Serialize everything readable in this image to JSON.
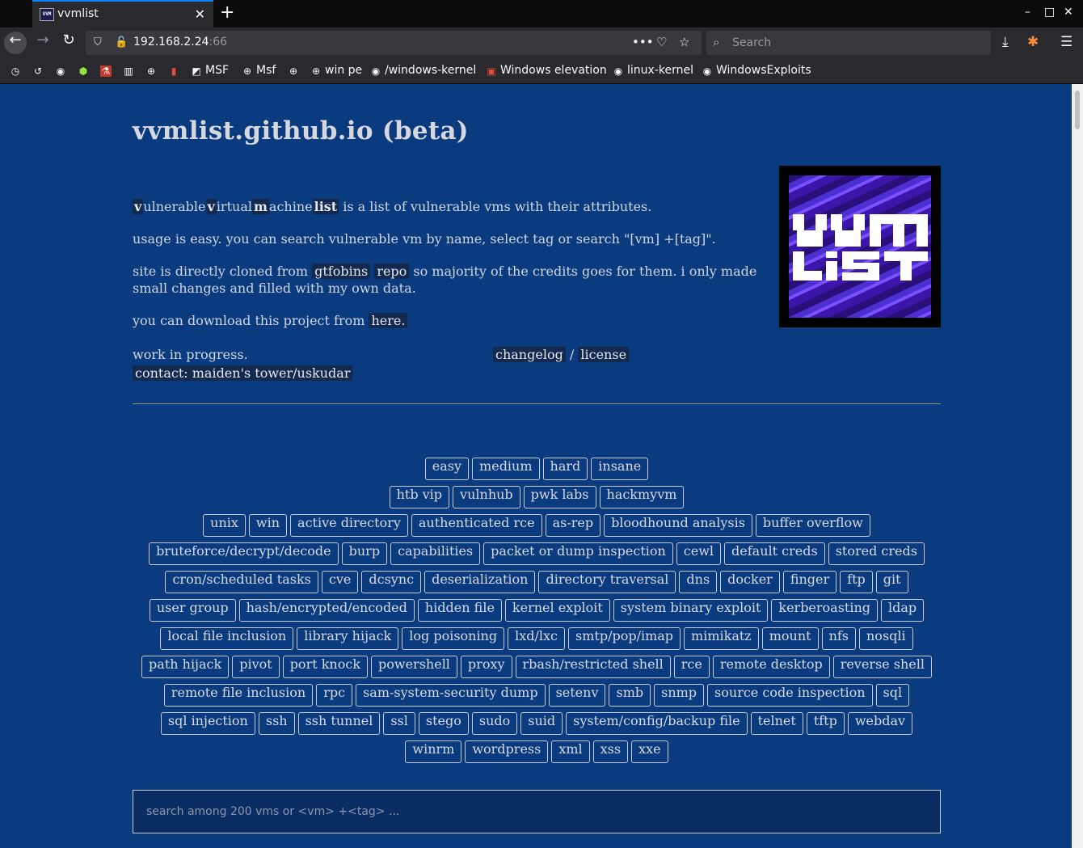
{
  "browser": {
    "tab_title": "vvmlist",
    "tab_favicon_text": "VVM",
    "url_host": "192.168.2.24",
    "url_port": ":66",
    "search_placeholder": "Search",
    "window_controls": {
      "minimize": "–",
      "maximize": "□",
      "close": "✕"
    },
    "bookmarks": [
      {
        "label": "",
        "icon": "clock-icon"
      },
      {
        "label": "",
        "icon": "history-icon"
      },
      {
        "label": "",
        "icon": "github-icon"
      },
      {
        "label": "",
        "icon": "cube-icon"
      },
      {
        "label": "",
        "icon": "flask-icon"
      },
      {
        "label": "",
        "icon": "film-icon"
      },
      {
        "label": "",
        "icon": "globe-icon"
      },
      {
        "label": "",
        "icon": "phone-icon"
      },
      {
        "label": "MSF",
        "icon": "image-icon"
      },
      {
        "label": "Msf",
        "icon": "globe-icon"
      },
      {
        "label": "",
        "icon": "globe-icon"
      },
      {
        "label": "win pe",
        "icon": "globe-icon"
      },
      {
        "label": "/windows-kernel",
        "icon": "github-icon"
      },
      {
        "label": "Windows elevation",
        "icon": "red-badge-icon"
      },
      {
        "label": "linux-kernel",
        "icon": "github-icon"
      },
      {
        "label": "WindowsExploits",
        "icon": "github-icon"
      }
    ]
  },
  "page": {
    "title": "vvmlist.github.io (beta)",
    "intro": {
      "v1": "v",
      "w1": "ulnerable",
      "v2": "v",
      "w2": "irtual",
      "v3": "m",
      "w3": "achine",
      "v4": "list",
      "rest": " is a list of vulnerable vms with their attributes."
    },
    "usage": "usage is easy. you can search vulnerable vm by name, select tag or search \"[vm] +[tag]\".",
    "cloned": {
      "before": "site is directly cloned from ",
      "link1": "gtfobins",
      "link2": "repo",
      "after": " so majority of the credits goes for them. i only made small changes and filled with my own data."
    },
    "download": {
      "before": "you can download this project from ",
      "link": "here."
    },
    "wip": "work in progress.",
    "contact": "contact: maiden's tower/uskudar",
    "changelog": "changelog",
    "separator": "/",
    "license": "license",
    "logo_text": "VVM LiST",
    "tag_rows": [
      [
        "easy",
        "medium",
        "hard",
        "insane"
      ],
      [
        "htb vip",
        "vulnhub",
        "pwk labs",
        "hackmyvm"
      ],
      [
        "unix",
        "win",
        "active directory",
        "authenticated rce",
        "as-rep",
        "bloodhound analysis",
        "buffer overflow"
      ],
      [
        "bruteforce/decrypt/decode",
        "burp",
        "capabilities",
        "packet or dump inspection",
        "cewl",
        "default creds",
        "stored creds"
      ],
      [
        "cron/scheduled tasks",
        "cve",
        "dcsync",
        "deserialization",
        "directory traversal",
        "dns",
        "docker",
        "finger",
        "ftp",
        "git"
      ],
      [
        "user group",
        "hash/encrypted/encoded",
        "hidden file",
        "kernel exploit",
        "system binary exploit",
        "kerberoasting",
        "ldap"
      ],
      [
        "local file inclusion",
        "library hijack",
        "log poisoning",
        "lxd/lxc",
        "smtp/pop/imap",
        "mimikatz",
        "mount",
        "nfs",
        "nosqli"
      ],
      [
        "path hijack",
        "pivot",
        "port knock",
        "powershell",
        "proxy",
        "rbash/restricted shell",
        "rce",
        "remote desktop",
        "reverse shell"
      ],
      [
        "remote file inclusion",
        "rpc",
        "sam-system-security dump",
        "setenv",
        "smb",
        "snmp",
        "source code inspection",
        "sql"
      ],
      [
        "sql injection",
        "ssh",
        "ssh tunnel",
        "ssl",
        "stego",
        "sudo",
        "suid",
        "system/config/backup file",
        "telnet",
        "tftp",
        "webdav"
      ],
      [
        "winrm",
        "wordpress",
        "xml",
        "xss",
        "xxe"
      ]
    ],
    "search_placeholder": "search among 200 vms or <vm> +<tag> ..."
  },
  "colors": {
    "page_bg": "#0b3b7f",
    "text": "#d2d6e2",
    "highlight_bg": "#13294e",
    "rule": "#9b8e73"
  }
}
